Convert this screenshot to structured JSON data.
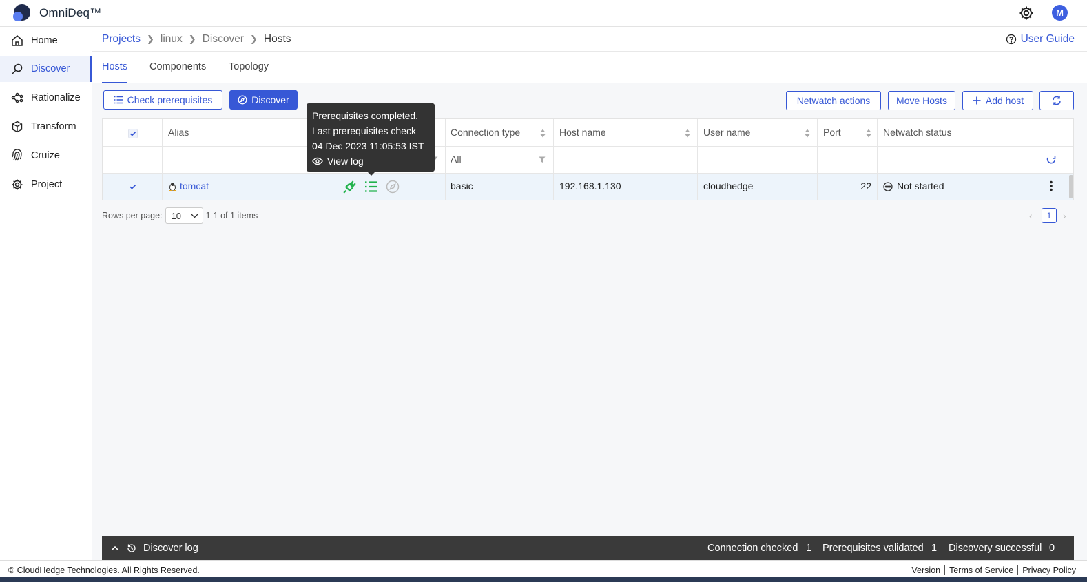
{
  "app": {
    "brand": "OmniDeq™"
  },
  "header": {
    "avatar_letter": "M"
  },
  "sidebar": {
    "items": [
      {
        "label": "Home",
        "icon": "home-icon"
      },
      {
        "label": "Discover",
        "icon": "discover-icon",
        "active": true
      },
      {
        "label": "Rationalize",
        "icon": "rationalize-icon"
      },
      {
        "label": "Transform",
        "icon": "cube-icon"
      },
      {
        "label": "Cruize",
        "icon": "fingerprint-icon"
      },
      {
        "label": "Project",
        "icon": "gear-icon"
      }
    ]
  },
  "breadcrumb": {
    "items": [
      "Projects",
      "linux",
      "Discover",
      "Hosts"
    ]
  },
  "user_guide": "User Guide",
  "tabs": [
    "Hosts",
    "Components",
    "Topology"
  ],
  "toolbar": {
    "check_prereq": "Check prerequisites",
    "discover": "Discover",
    "netwatch_actions": "Netwatch actions",
    "move_hosts": "Move Hosts",
    "add_host": "Add host"
  },
  "table": {
    "columns": [
      "Alias",
      "Connection type",
      "Host name",
      "User name",
      "Port",
      "Netwatch status"
    ],
    "filter_connection_type": "All",
    "rows": [
      {
        "alias": "tomcat",
        "connection_type": "basic",
        "host_name": "192.168.1.130",
        "user_name": "cloudhedge",
        "port": "22",
        "netwatch_status": "Not started"
      }
    ]
  },
  "tooltip": {
    "line1": "Prerequisites completed.",
    "line2": "Last prerequisites check",
    "line3": "04 Dec 2023 11:05:53 IST",
    "view_log": "View log"
  },
  "pagination": {
    "rows_per_page_label": "Rows per page:",
    "rows_per_page": "10",
    "range": "1-1 of 1 items",
    "current_page": "1"
  },
  "discover_log": {
    "title": "Discover log",
    "connection_checked_label": "Connection checked",
    "connection_checked": "1",
    "prereq_validated_label": "Prerequisites validated",
    "prereq_validated": "1",
    "discovery_successful_label": "Discovery successful",
    "discovery_successful": "0"
  },
  "footer": {
    "copyright": "© CloudHedge Technologies. All Rights Reserved.",
    "links": [
      "Version",
      "Terms of Service",
      "Privacy Policy"
    ]
  },
  "colors": {
    "accent": "#3758d6",
    "success": "#22b24c",
    "dark": "#333333"
  }
}
